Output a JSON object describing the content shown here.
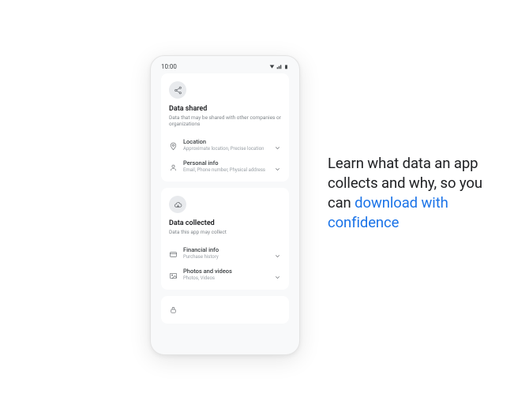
{
  "status": {
    "time": "10:00"
  },
  "shared": {
    "title": "Data shared",
    "subtitle": "Data that may be shared with other companies or organizations",
    "rows": [
      {
        "title": "Location",
        "sub": "Approximate location, Precise location"
      },
      {
        "title": "Personal info",
        "sub": "Email, Phone number, Physical address"
      }
    ]
  },
  "collected": {
    "title": "Data collected",
    "subtitle": "Data this app may collect",
    "rows": [
      {
        "title": "Financial info",
        "sub": "Purchase history"
      },
      {
        "title": "Photos and videos",
        "sub": "Photos, Videos"
      }
    ]
  },
  "headline": {
    "line1": "Learn what data an app collects and why, so you can ",
    "accent": "download with confidence"
  }
}
